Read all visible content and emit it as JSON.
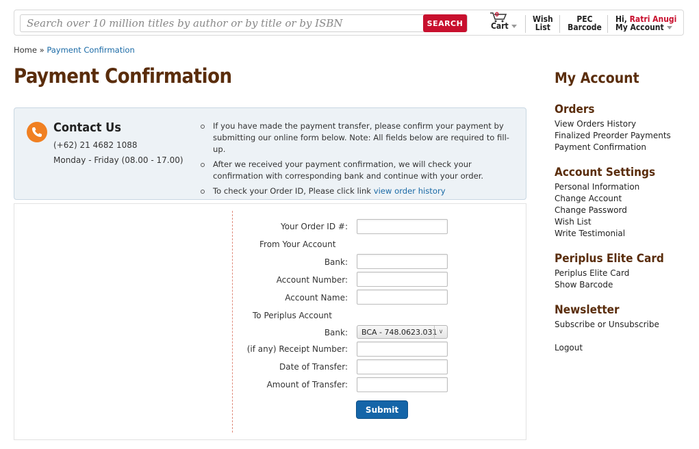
{
  "header": {
    "search_placeholder": "Search over 10 million titles by author or by title or by ISBN",
    "search_button": "SEARCH",
    "cart_count": "0",
    "cart_label": "Cart",
    "wishlist_line1": "Wish",
    "wishlist_line2": "List",
    "pec_line1": "PEC",
    "pec_line2": "Barcode",
    "greeting": "Hi,",
    "user_name": "Ratri Anugi",
    "account_label": "My Account"
  },
  "breadcrumb": {
    "home": "Home",
    "separator": "»",
    "current": "Payment Confirmation"
  },
  "page_title": "Payment Confirmation",
  "contact": {
    "title": "Contact Us",
    "phone": "(+62) 21 4682 1088",
    "hours": "Monday - Friday (08.00 - 17.00)",
    "bullets": [
      "If you have made the payment transfer, please confirm your payment by submitting our online form below. Note: All fields below are required to fill-up.",
      "After we received your payment confirmation, we will check your confirmation with corresponding bank and continue with your order."
    ],
    "bullet3_text": "To check your Order ID, Please click link",
    "bullet3_link": "view order history"
  },
  "form": {
    "order_id_label": "Your Order ID #:",
    "from_section": "From Your Account",
    "bank_label": "Bank:",
    "account_number_label": "Account Number:",
    "account_name_label": "Account Name:",
    "to_section": "To Periplus Account",
    "to_bank_label": "Bank:",
    "to_bank_selected": "BCA - 748.0623.031",
    "receipt_label": "(if any) Receipt Number:",
    "date_label": "Date of Transfer:",
    "amount_label": "Amount of Transfer:",
    "submit": "Submit"
  },
  "sidebar": {
    "title": "My Account",
    "orders_heading": "Orders",
    "orders_links": [
      "View Orders History",
      "Finalized Preorder Payments",
      "Payment Confirmation"
    ],
    "settings_heading": "Account Settings",
    "settings_links": [
      "Personal Information",
      "Change Account",
      "Change Password",
      "Wish List",
      "Write Testimonial"
    ],
    "elite_heading": "Periplus Elite Card",
    "elite_links": [
      "Periplus Elite Card",
      "Show Barcode"
    ],
    "newsletter_heading": "Newsletter",
    "newsletter_link": "Subscribe or Unsubscribe",
    "logout": "Logout"
  },
  "colors": {
    "brand_brown": "#5a2d0c",
    "search_red": "#c8102e",
    "link_blue": "#1a6aa6",
    "submit_blue": "#1565a8",
    "phone_orange": "#f08022"
  }
}
